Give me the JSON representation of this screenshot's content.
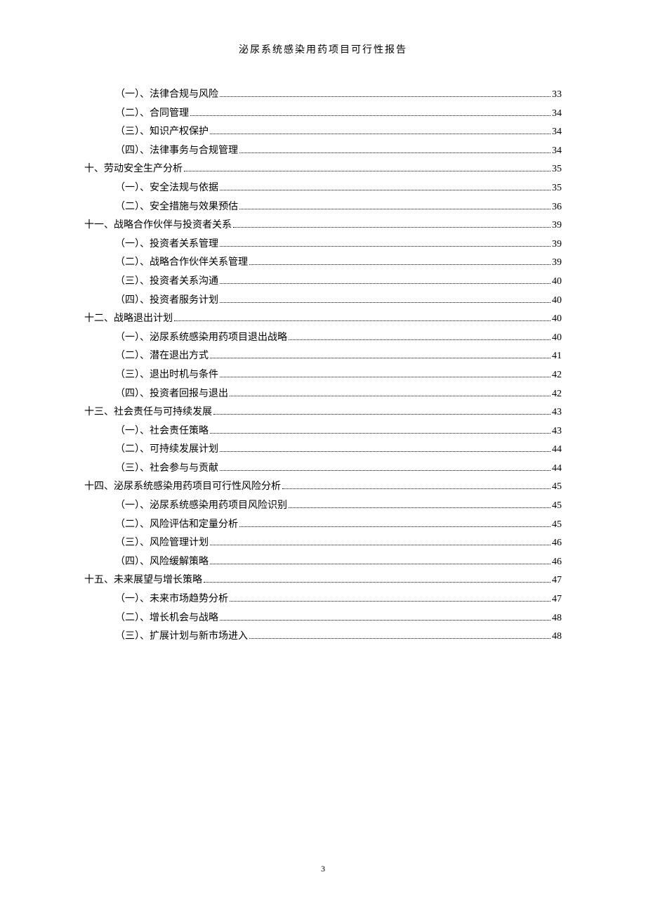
{
  "header": "泌尿系统感染用药项目可行性报告",
  "pageNumber": "3",
  "toc": [
    {
      "level": 2,
      "label": "（一）、法律合规与风险",
      "page": "33"
    },
    {
      "level": 2,
      "label": "（二）、合同管理",
      "page": "34"
    },
    {
      "level": 2,
      "label": "（三）、知识产权保护",
      "page": "34"
    },
    {
      "level": 2,
      "label": "（四）、法律事务与合规管理",
      "page": "34"
    },
    {
      "level": 1,
      "label": "十、劳动安全生产分析",
      "page": "35"
    },
    {
      "level": 2,
      "label": "（一）、安全法规与依据",
      "page": "35"
    },
    {
      "level": 2,
      "label": "（二）、安全措施与效果预估",
      "page": "36"
    },
    {
      "level": 1,
      "label": "十一、战略合作伙伴与投资者关系",
      "page": "39"
    },
    {
      "level": 2,
      "label": "（一）、投资者关系管理",
      "page": "39"
    },
    {
      "level": 2,
      "label": "（二）、战略合作伙伴关系管理",
      "page": "39"
    },
    {
      "level": 2,
      "label": "（三）、投资者关系沟通",
      "page": "40"
    },
    {
      "level": 2,
      "label": "（四）、投资者服务计划",
      "page": "40"
    },
    {
      "level": 1,
      "label": "十二、战略退出计划",
      "page": "40"
    },
    {
      "level": 2,
      "label": "（一）、泌尿系统感染用药项目退出战略",
      "page": "40"
    },
    {
      "level": 2,
      "label": "（二）、潜在退出方式",
      "page": "41"
    },
    {
      "level": 2,
      "label": "（三）、退出时机与条件",
      "page": "42"
    },
    {
      "level": 2,
      "label": "（四）、投资者回报与退出",
      "page": "42"
    },
    {
      "level": 1,
      "label": "十三、社会责任与可持续发展",
      "page": "43"
    },
    {
      "level": 2,
      "label": "（一）、社会责任策略",
      "page": "43"
    },
    {
      "level": 2,
      "label": "（二）、可持续发展计划",
      "page": "44"
    },
    {
      "level": 2,
      "label": "（三）、社会参与与贡献",
      "page": "44"
    },
    {
      "level": 1,
      "label": "十四、泌尿系统感染用药项目可行性风险分析",
      "page": "45"
    },
    {
      "level": 2,
      "label": "（一）、泌尿系统感染用药项目风险识别",
      "page": "45"
    },
    {
      "level": 2,
      "label": "（二）、风险评估和定量分析",
      "page": "45"
    },
    {
      "level": 2,
      "label": "（三）、风险管理计划",
      "page": "46"
    },
    {
      "level": 2,
      "label": "（四）、风险缓解策略",
      "page": "46"
    },
    {
      "level": 1,
      "label": "十五、未来展望与增长策略",
      "page": "47"
    },
    {
      "level": 2,
      "label": "（一）、未来市场趋势分析",
      "page": "47"
    },
    {
      "level": 2,
      "label": "（二）、增长机会与战略",
      "page": "48"
    },
    {
      "level": 2,
      "label": "（三）、扩展计划与新市场进入",
      "page": "48"
    }
  ]
}
